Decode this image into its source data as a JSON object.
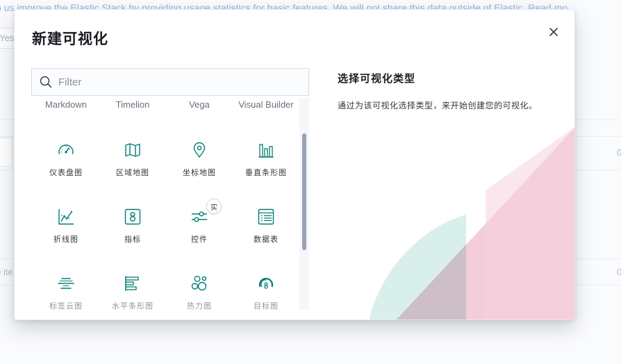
{
  "background": {
    "banner_text": "p us improve the Elastic Stack by providing usage statistics for basic features. We will not share this data outside of Elastic. Read mo",
    "yes_button": "Yes",
    "items_text": "0 ite",
    "zero_1": "0",
    "zero_2": "0"
  },
  "modal": {
    "title": "新建可视化",
    "filter": {
      "placeholder": "Filter",
      "value": ""
    },
    "headers": [
      "Markdown",
      "Timelion",
      "Vega",
      "Visual Builder"
    ],
    "types": [
      {
        "label": "仪表盘图",
        "icon": "gauge-icon"
      },
      {
        "label": "区域地图",
        "icon": "region-map-icon"
      },
      {
        "label": "坐标地图",
        "icon": "map-pin-icon"
      },
      {
        "label": "垂直条形图",
        "icon": "vertical-bar-icon"
      },
      {
        "label": "折线图",
        "icon": "line-chart-icon"
      },
      {
        "label": "指标",
        "icon": "metric-icon"
      },
      {
        "label": "控件",
        "icon": "controls-icon",
        "badge": "实"
      },
      {
        "label": "数据表",
        "icon": "data-table-icon"
      },
      {
        "label": "标签云图",
        "icon": "tag-cloud-icon"
      },
      {
        "label": "水平条形图",
        "icon": "horizontal-bar-icon"
      },
      {
        "label": "热力图",
        "icon": "heatmap-icon"
      },
      {
        "label": "目标图",
        "icon": "goal-icon"
      }
    ],
    "description": {
      "title": "选择可视化类型",
      "text": "通过为该可视化选择类型，来开始创建您的可视化。"
    }
  },
  "colors": {
    "icon": "#017d73",
    "accent_pink": "#f0c9d6",
    "accent_teal": "#d4ece9"
  }
}
